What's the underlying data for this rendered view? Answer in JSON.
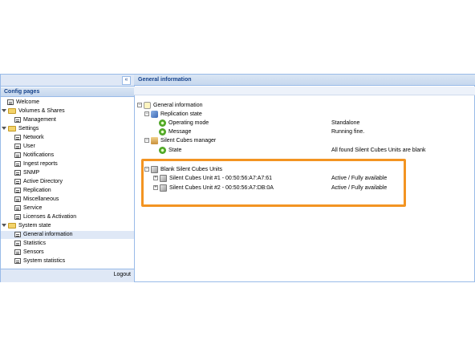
{
  "sidebar": {
    "collapse_glyph": "«",
    "title": "Config pages",
    "items": [
      {
        "label": "Welcome",
        "icon": "page-icon",
        "level": 1
      },
      {
        "label": "Volumes & Shares",
        "icon": "folder-icon",
        "level": 0
      },
      {
        "label": "Management",
        "icon": "page-icon",
        "level": 2
      },
      {
        "label": "Settings",
        "icon": "folder-icon",
        "level": 0
      },
      {
        "label": "Network",
        "icon": "page-icon",
        "level": 2
      },
      {
        "label": "User",
        "icon": "page-icon",
        "level": 2
      },
      {
        "label": "Notifications",
        "icon": "page-icon",
        "level": 2
      },
      {
        "label": "Ingest reports",
        "icon": "page-icon",
        "level": 2
      },
      {
        "label": "SNMP",
        "icon": "page-icon",
        "level": 2
      },
      {
        "label": "Active Directory",
        "icon": "page-icon",
        "level": 2
      },
      {
        "label": "Replication",
        "icon": "page-icon",
        "level": 2
      },
      {
        "label": "Miscellaneous",
        "icon": "page-icon",
        "level": 2
      },
      {
        "label": "Service",
        "icon": "page-icon",
        "level": 2
      },
      {
        "label": "Licenses & Activation",
        "icon": "page-icon",
        "level": 2
      },
      {
        "label": "System state",
        "icon": "folder-icon",
        "level": 0
      },
      {
        "label": "General information",
        "icon": "page-icon",
        "level": 2,
        "selected": true
      },
      {
        "label": "Statistics",
        "icon": "page-icon",
        "level": 2
      },
      {
        "label": "Sensors",
        "icon": "page-icon",
        "level": 2
      },
      {
        "label": "System statistics",
        "icon": "page-icon",
        "level": 2
      }
    ],
    "logout_label": "Logout"
  },
  "main": {
    "title": "General information",
    "tree": [
      {
        "label": "General information",
        "value": "",
        "icon": "leaf-icon",
        "toggle": "−"
      },
      {
        "label": "Replication state",
        "value": "",
        "icon": "replication-icon",
        "toggle": "−"
      },
      {
        "label": "Operating mode",
        "value": "Standalone",
        "icon": "gear-icon",
        "toggle": ""
      },
      {
        "label": "Message",
        "value": "Running fine.",
        "icon": "gear-icon",
        "toggle": ""
      },
      {
        "label": "Silent Cubes manager",
        "value": "",
        "icon": "house-icon",
        "toggle": "−"
      },
      {
        "label": "State",
        "value": "All found Silent Cubes Units are blank",
        "icon": "gear-icon",
        "toggle": ""
      },
      {
        "label": "Blank Silent Cubes Units",
        "value": "",
        "icon": "cube-icon",
        "toggle": "−"
      },
      {
        "label": "Silent Cubes Unit #1 - 00:50:56:A7:A7:61",
        "value": "Active / Fully available",
        "icon": "cube-icon",
        "toggle": "+"
      },
      {
        "label": "Silent Cubes Unit #2 - 00:50:56:A7:DB:0A",
        "value": "Active / Fully available",
        "icon": "cube-icon",
        "toggle": "+"
      }
    ]
  },
  "colors": {
    "highlight": "#f39422",
    "panel_border": "#99bbe8",
    "header_text": "#15428b"
  }
}
